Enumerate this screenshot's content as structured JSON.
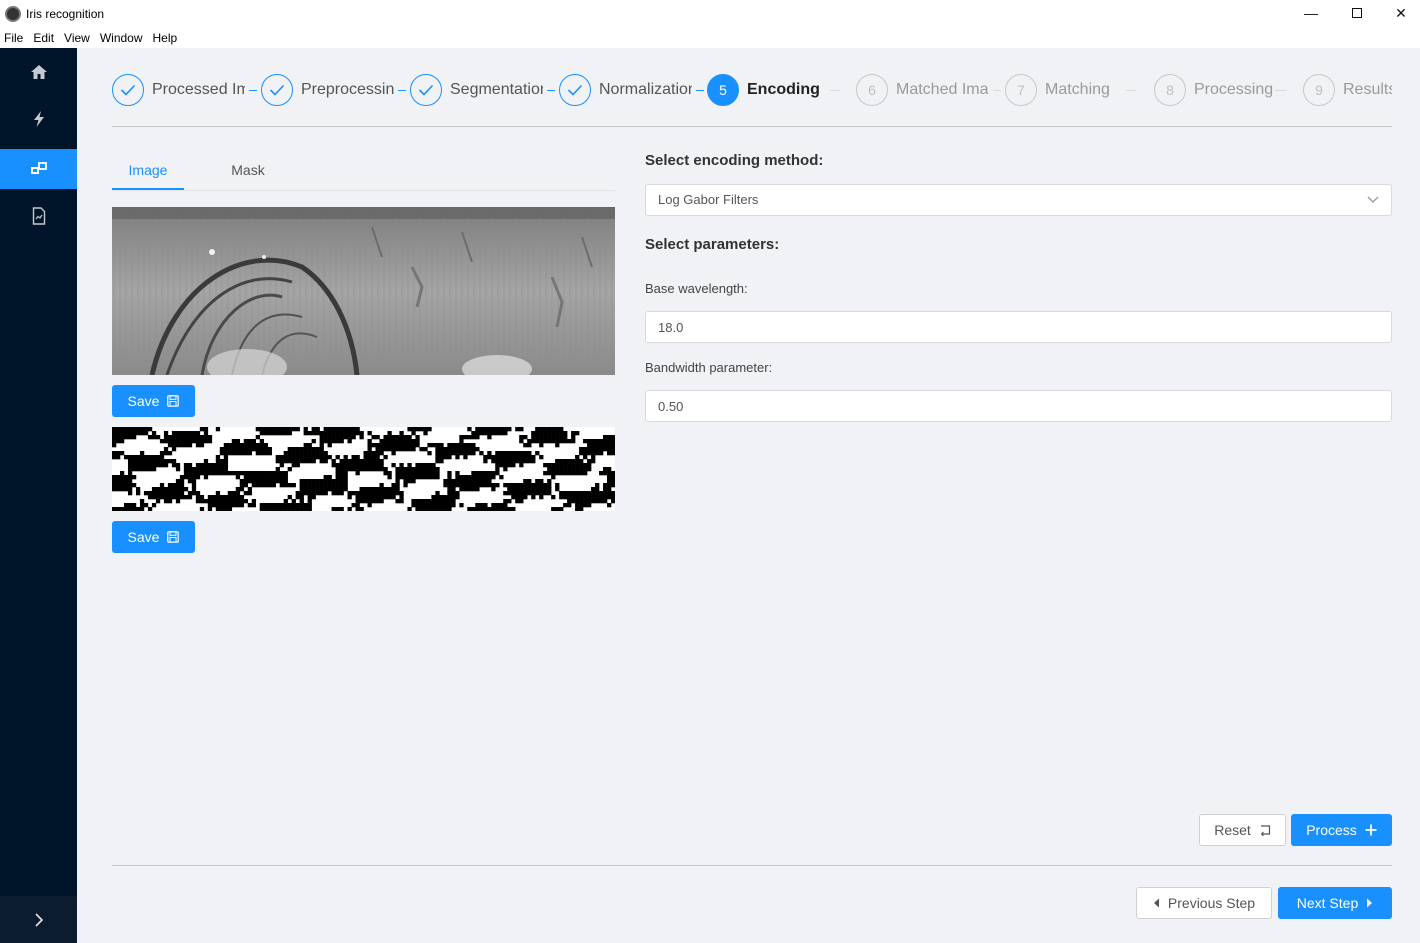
{
  "window": {
    "title": "Iris recognition",
    "controls": {
      "minimize": "—",
      "close": "✕"
    }
  },
  "menu": [
    "File",
    "Edit",
    "View",
    "Window",
    "Help"
  ],
  "sidebar": {
    "items": [
      {
        "icon": "home-icon",
        "active": false
      },
      {
        "icon": "lightning-icon",
        "active": false
      },
      {
        "icon": "blocks-icon",
        "active": true
      },
      {
        "icon": "document-icon",
        "active": false
      }
    ],
    "expand_icon": "chevron-right-icon"
  },
  "steps": [
    {
      "number": "1",
      "title": "Processed Im",
      "status": "finished"
    },
    {
      "number": "2",
      "title": "Preprocessing",
      "status": "finished"
    },
    {
      "number": "3",
      "title": "Segmentation",
      "status": "finished"
    },
    {
      "number": "4",
      "title": "Normalization",
      "status": "finished"
    },
    {
      "number": "5",
      "title": "Encoding",
      "status": "active"
    },
    {
      "number": "6",
      "title": "Matched Ima",
      "status": "wait"
    },
    {
      "number": "7",
      "title": "Matching",
      "status": "wait"
    },
    {
      "number": "8",
      "title": "Processing",
      "status": "wait"
    },
    {
      "number": "9",
      "title": "Results",
      "status": "wait"
    }
  ],
  "tabs": [
    {
      "label": "Image",
      "active": true
    },
    {
      "label": "Mask",
      "active": false
    }
  ],
  "image_panel": {
    "save_label_1": "Save",
    "save_label_2": "Save"
  },
  "encoding": {
    "method_heading": "Select encoding method:",
    "method_value": "Log Gabor Filters",
    "params_heading": "Select parameters:",
    "wavelength_label": "Base wavelength:",
    "wavelength_value": "18.0",
    "bandwidth_label": "Bandwidth parameter:",
    "bandwidth_value": "0.50"
  },
  "actions": {
    "reset_label": "Reset",
    "process_label": "Process"
  },
  "navigation": {
    "previous_label": "Previous Step",
    "next_label": "Next Step"
  },
  "colors": {
    "primary": "#1890ff",
    "sidebar": "#001529",
    "background": "#f0f2f5"
  }
}
